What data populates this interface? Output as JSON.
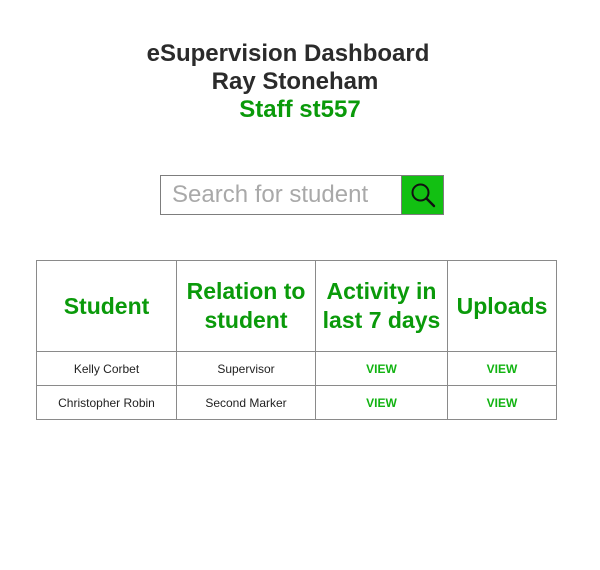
{
  "header": {
    "title": "eSupervision Dashboard",
    "user_name": "Ray Stoneham",
    "staff_id": "Staff st557"
  },
  "search": {
    "placeholder": "Search for student",
    "value": "",
    "button_icon": "search-icon"
  },
  "colors": {
    "accent_green": "#0a9a0a",
    "button_green": "#12c012",
    "link_green": "#12b312"
  },
  "table": {
    "headers": [
      "Student",
      "Relation to student",
      "Activity in last 7 days",
      "Uploads"
    ],
    "rows": [
      {
        "student": "Kelly Corbet",
        "relation": "Supervisor",
        "activity": "VIEW",
        "uploads": "VIEW"
      },
      {
        "student": "Christopher Robin",
        "relation": "Second Marker",
        "activity": "VIEW",
        "uploads": "VIEW"
      }
    ]
  }
}
